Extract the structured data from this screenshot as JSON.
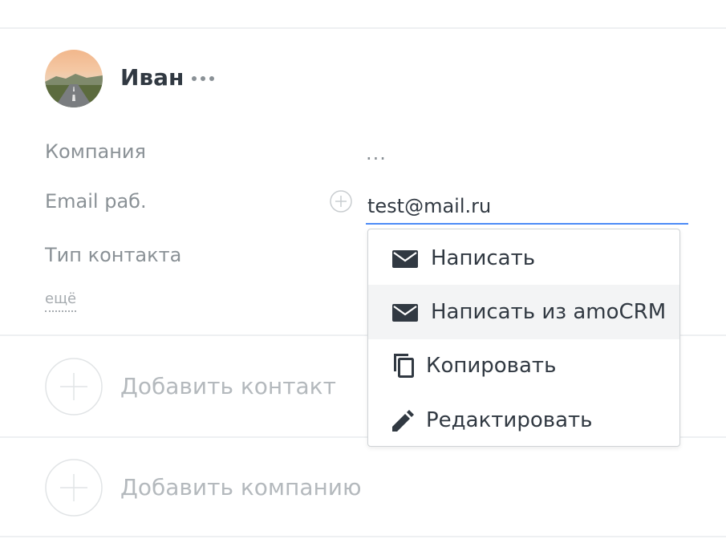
{
  "contact": {
    "name": "Иван"
  },
  "fields": {
    "company_label": "Компания",
    "company_value": "...",
    "email_label": "Email раб.",
    "email_value": "test@mail.ru",
    "contact_type_label": "Тип контакта",
    "more_link": "ещё"
  },
  "email_menu": {
    "items": [
      {
        "label": "Написать",
        "icon": "envelope-icon"
      },
      {
        "label": "Написать из amoCRM",
        "icon": "envelope-icon"
      },
      {
        "label": "Копировать",
        "icon": "copy-icon"
      },
      {
        "label": "Редактировать",
        "icon": "pencil-icon"
      }
    ],
    "highlighted_index": 1
  },
  "actions": {
    "add_contact": "Добавить контакт",
    "add_company": "Добавить компанию"
  },
  "colors": {
    "input_focus": "#4c8bf7",
    "text_primary": "#313942",
    "text_muted": "#8a9196",
    "text_placeholder": "#b4b9bd",
    "menu_hover": "#f3f4f5"
  }
}
